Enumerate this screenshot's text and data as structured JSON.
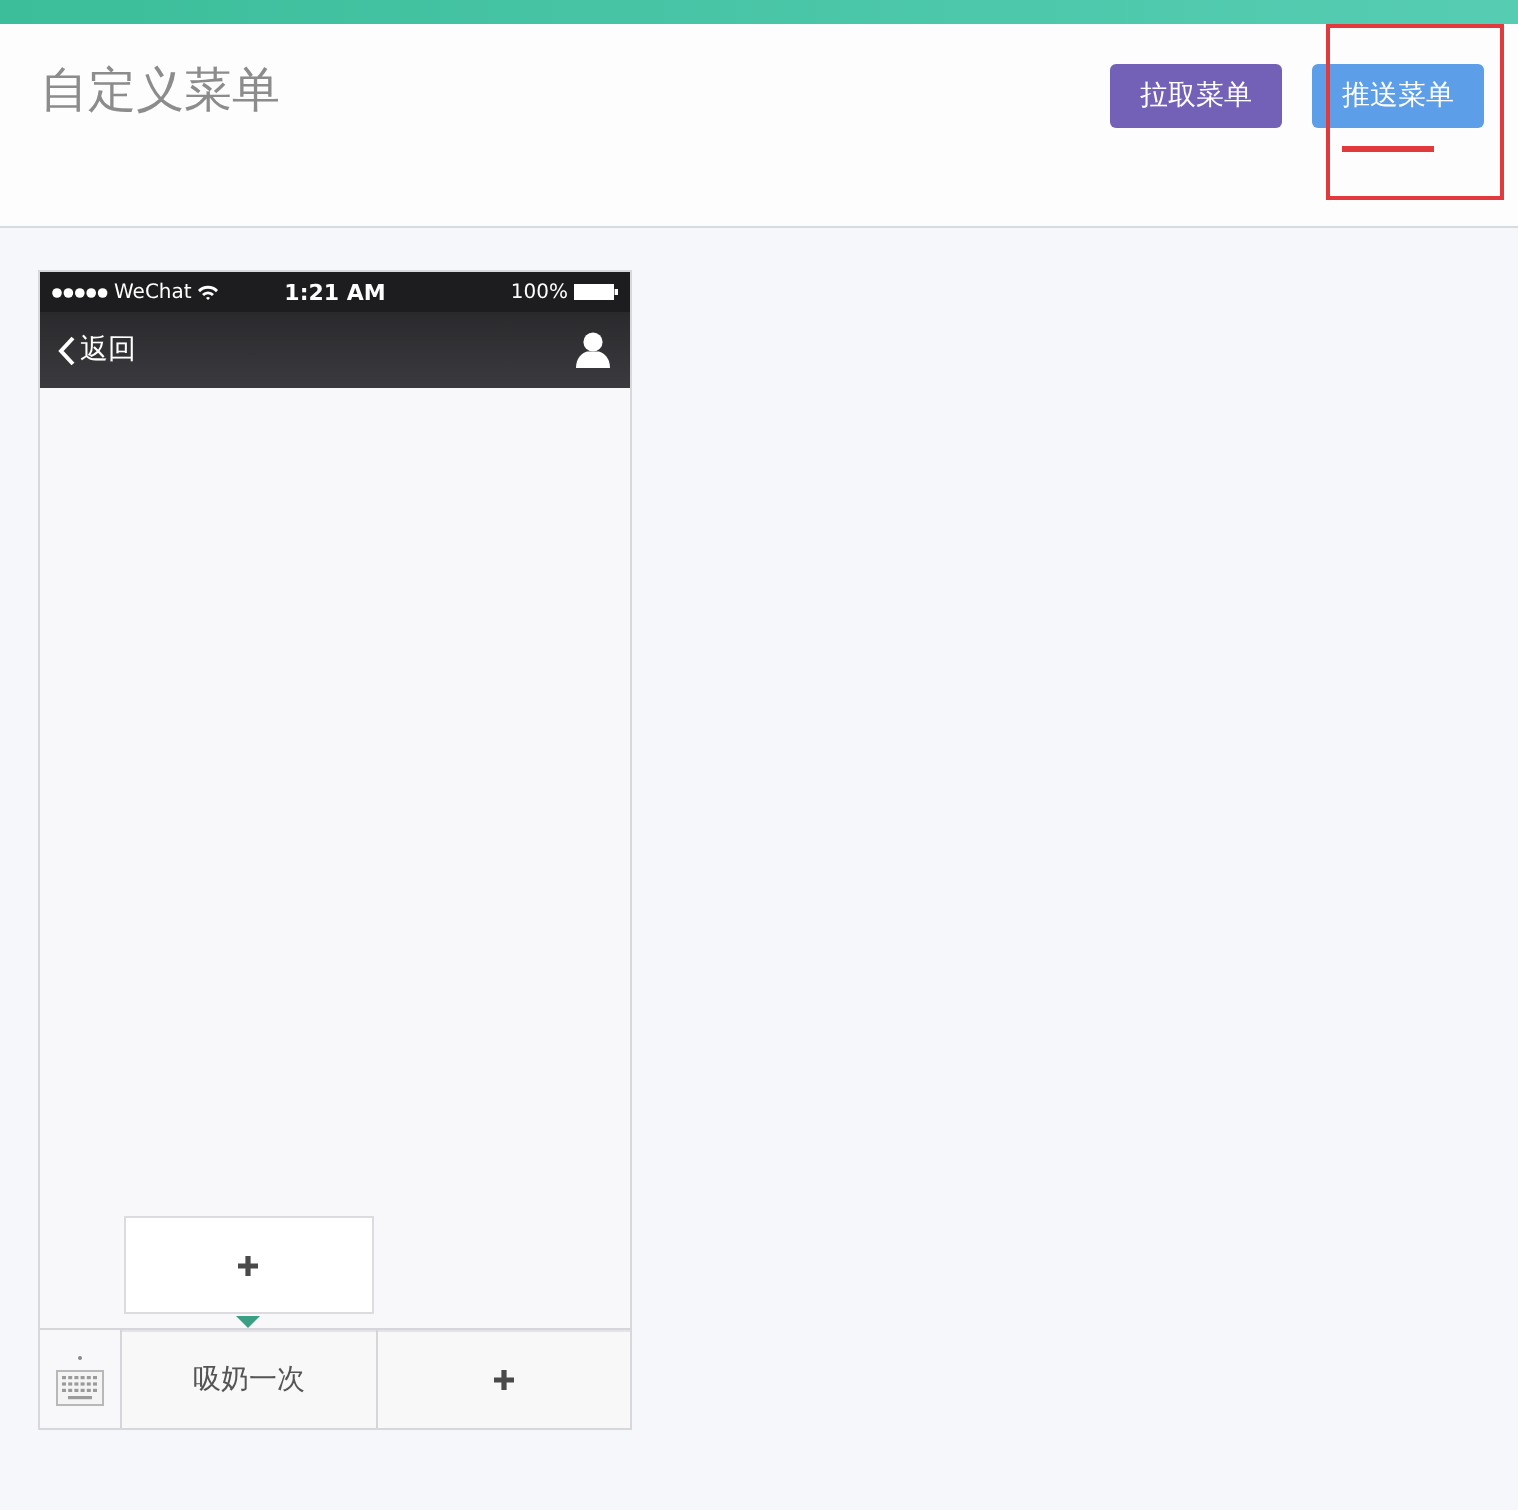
{
  "header": {
    "title": "自定义菜单",
    "buttons": [
      {
        "label": "拉取菜单",
        "kind": "pull",
        "marked": false
      },
      {
        "label": "推送菜单",
        "kind": "push",
        "marked": true
      }
    ]
  },
  "phone": {
    "status_bar": {
      "carrier": "WeChat",
      "time": "1:21 AM",
      "battery": "100%"
    },
    "nav": {
      "back": "返回"
    },
    "menu": [
      {
        "kind": "item",
        "label": "吸奶一次",
        "submenu": [
          {
            "kind": "add"
          }
        ]
      },
      {
        "kind": "add"
      }
    ]
  }
}
